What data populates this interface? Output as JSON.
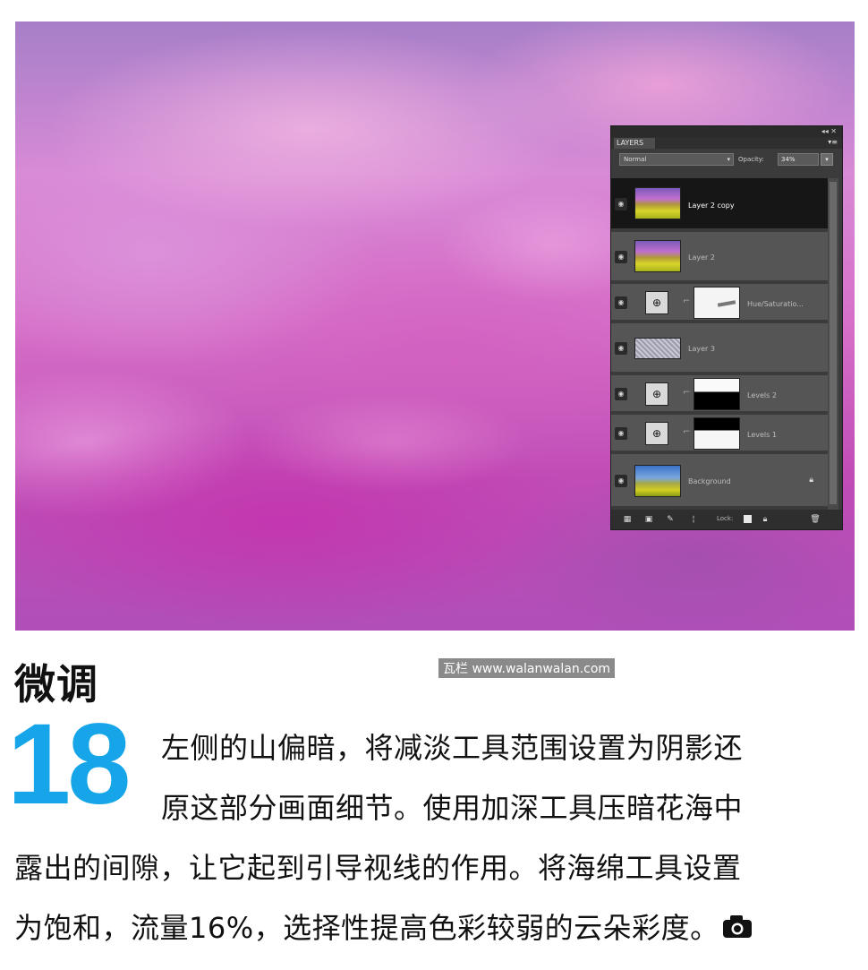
{
  "panel": {
    "tab_label": "LAYERS",
    "blend_mode": "Normal",
    "opacity_label": "Opacity:",
    "opacity_value": "34%",
    "lock_label": "Lock:",
    "layers": [
      {
        "name": "Layer 2 copy",
        "type": "photo",
        "selected": true
      },
      {
        "name": "Layer 2",
        "type": "photo",
        "selected": false
      },
      {
        "name": "Hue/Saturatio...",
        "type": "adjustment",
        "selected": false
      },
      {
        "name": "Layer 3",
        "type": "pattern",
        "selected": false
      },
      {
        "name": "Levels 2",
        "type": "adjustment",
        "selected": false
      },
      {
        "name": "Levels 1",
        "type": "adjustment",
        "selected": false
      },
      {
        "name": "Background",
        "type": "background",
        "selected": false,
        "locked": true
      }
    ]
  },
  "article": {
    "heading": "微调",
    "watermark": "瓦栏 www.walanwalan.com",
    "step_number": "18",
    "lines": [
      "左侧的山偏暗，将减淡工具范围设置为阴影还",
      "原这部分画面细节。使用加深工具压暗花海中",
      "露出的间隙，让它起到引导视线的作用。将海绵工具设置",
      "为饱和，流量16%，选择性提高色彩较弱的云朵彩度。"
    ],
    "end_icon": "camera-icon"
  },
  "colors": {
    "step_number": "#16a5e8",
    "panel_bg": "#3b3b3b",
    "selected_row": "#161616"
  }
}
